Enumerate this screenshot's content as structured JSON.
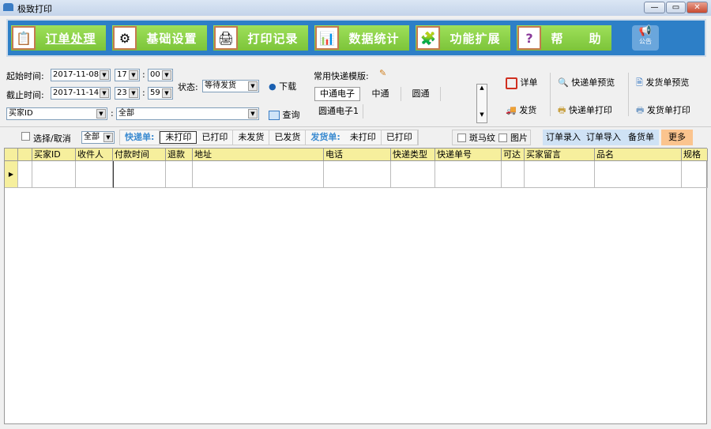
{
  "window": {
    "title": "极致打印",
    "min": "—",
    "max": "▭",
    "close": "✕"
  },
  "nav": [
    {
      "label": "订单处理",
      "icon": "order-icon",
      "glyph": "📋"
    },
    {
      "label": "基础设置",
      "icon": "gear-icon",
      "glyph": "⚙"
    },
    {
      "label": "打印记录",
      "icon": "print-record-icon",
      "glyph": "🖨"
    },
    {
      "label": "数据统计",
      "icon": "chart-icon",
      "glyph": "📊"
    },
    {
      "label": "功能扩展",
      "icon": "extension-icon",
      "glyph": "🧩"
    },
    {
      "label": "帮　　助",
      "icon": "help-icon",
      "glyph": "?"
    }
  ],
  "notice": "公告",
  "filters": {
    "start_label": "起始时间:",
    "start_date": "2017-11-08",
    "start_hour": "17",
    "start_min": "00",
    "end_label": "截止时间:",
    "end_date": "2017-11-14",
    "end_hour": "23",
    "end_min": "59",
    "colon": ":",
    "status_label": "状态:",
    "status": "等待发货",
    "field": "买家ID",
    "field_value": "全部",
    "download": "下载",
    "query": "查询"
  },
  "templates": {
    "label": "常用快递模版:",
    "items": [
      "中通电子",
      "中通",
      "圆通",
      "圆通电子1"
    ]
  },
  "actions": {
    "detail": "详单",
    "ship": "发货",
    "express_preview": "快递单预览",
    "express_print": "快递单打印",
    "invoice_preview": "发货单预览",
    "invoice_print": "发货单打印"
  },
  "toolbar": {
    "select_all": "选择/取消",
    "scope": "全部",
    "express_label": "快递单:",
    "express_tabs": [
      "未打印",
      "已打印",
      "未发货",
      "已发货"
    ],
    "invoice_label": "发货单:",
    "invoice_tabs": [
      "未打印",
      "已打印"
    ],
    "zebra": "斑马纹",
    "image": "图片",
    "order_entry": "订单录入",
    "order_import": "订单导入",
    "stock_list": "备货单",
    "more": "更多"
  },
  "columns": [
    "买家ID",
    "收件人",
    "付款时间",
    "退款",
    "地址",
    "电话",
    "快递类型",
    "快递单号",
    "可达",
    "买家留言",
    "品名",
    "规格"
  ]
}
